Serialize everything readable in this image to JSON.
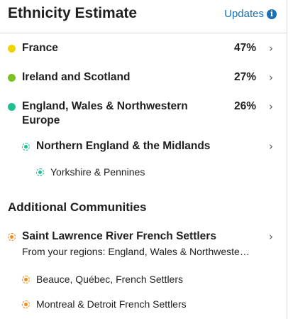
{
  "header": {
    "title": "Ethnicity Estimate",
    "updates_label": "Updates",
    "info_glyph": "i"
  },
  "colors": {
    "france": "#f2d500",
    "ireland": "#7cc11f",
    "england": "#1fbf91",
    "community": "#f08c1e",
    "link": "#1b6fb5"
  },
  "regions": [
    {
      "name": "France",
      "percent": "47%"
    },
    {
      "name": "Ireland and Scotland",
      "percent": "27%"
    },
    {
      "name": "England, Wales & Northwestern",
      "name2": "Europe",
      "percent": "26%"
    }
  ],
  "subregion": {
    "name": "Northern England & the Midlands",
    "child": "Yorkshire & Pennines"
  },
  "additional": {
    "title": "Additional Communities",
    "community": {
      "name": "Saint Lawrence River French Settlers",
      "from": "From your regions: England, Wales & Northweste…"
    },
    "children": [
      "Beauce, Québec, French Settlers",
      "Montreal & Detroit French Settlers"
    ]
  },
  "icons": {
    "chevron": "chevron-right-icon",
    "info": "info-icon"
  }
}
